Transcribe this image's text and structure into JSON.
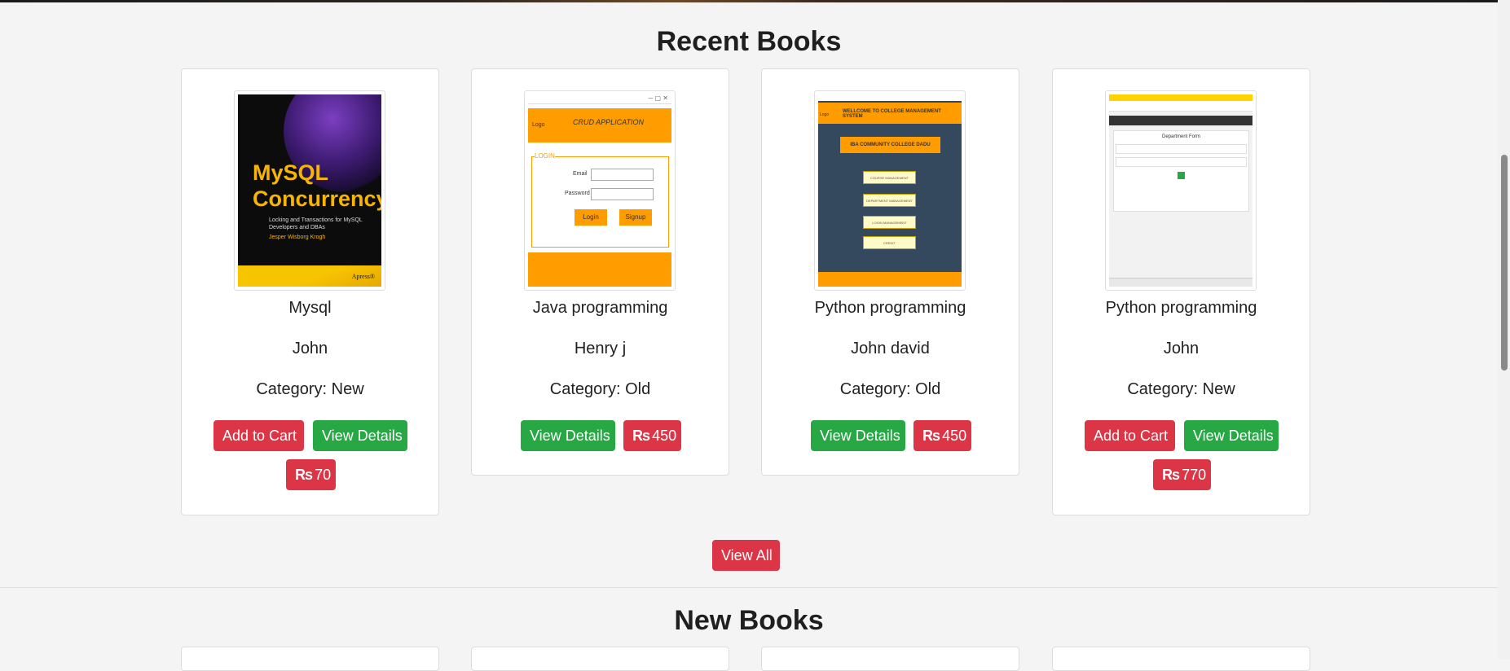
{
  "recent_section": {
    "title": "Recent Books",
    "books": [
      {
        "title": "Mysql",
        "author": "John",
        "category": "Category: New",
        "add_to_cart": "Add to Cart",
        "view_details": "View Details",
        "price_symbol": "₨",
        "price": "70",
        "cover": {
          "title_line1": "MySQL",
          "title_line2": "Concurrency",
          "subtitle": "Locking and Transactions for MySQL Developers and DBAs",
          "author": "Jesper Wisborg Krogh",
          "publisher": "Apress®"
        }
      },
      {
        "title": "Java programming",
        "author": "Henry j",
        "category": "Category: Old",
        "view_details": "View Details",
        "price_symbol": "₨",
        "price": "450",
        "cover": {
          "logo": "Logo",
          "heading": "CRUD APPLICATION",
          "legend": "LOGIN",
          "email_label": "Email",
          "password_label": "Password",
          "login": "Login",
          "signup": "Signup"
        }
      },
      {
        "title": "Python programming",
        "author": "John david",
        "category": "Category: Old",
        "view_details": "View Details",
        "price_symbol": "₨",
        "price": "450",
        "cover": {
          "heading": "WELLCOME TO COLLEGE MANAGEMENT SYSTEM",
          "logo": "Logo",
          "college": "IBA COMMUNITY COLLEGE DADU",
          "menu": [
            "COURSE MANAGEMENT",
            "DEPARTMENT MANAGEMENT",
            "LOGIN MANAGEMENT",
            "CREDIT"
          ]
        }
      },
      {
        "title": "Python programming",
        "author": "John",
        "category": "Category: New",
        "add_to_cart": "Add to Cart",
        "view_details": "View Details",
        "price_symbol": "₨",
        "price": "770",
        "cover": {
          "form_title": "Department Form"
        }
      }
    ],
    "view_all": "View All"
  },
  "new_section": {
    "title": "New Books"
  },
  "colors": {
    "danger": "#dc3545",
    "success": "#28a745",
    "orange": "#ff9c00",
    "slate": "#34495e"
  }
}
